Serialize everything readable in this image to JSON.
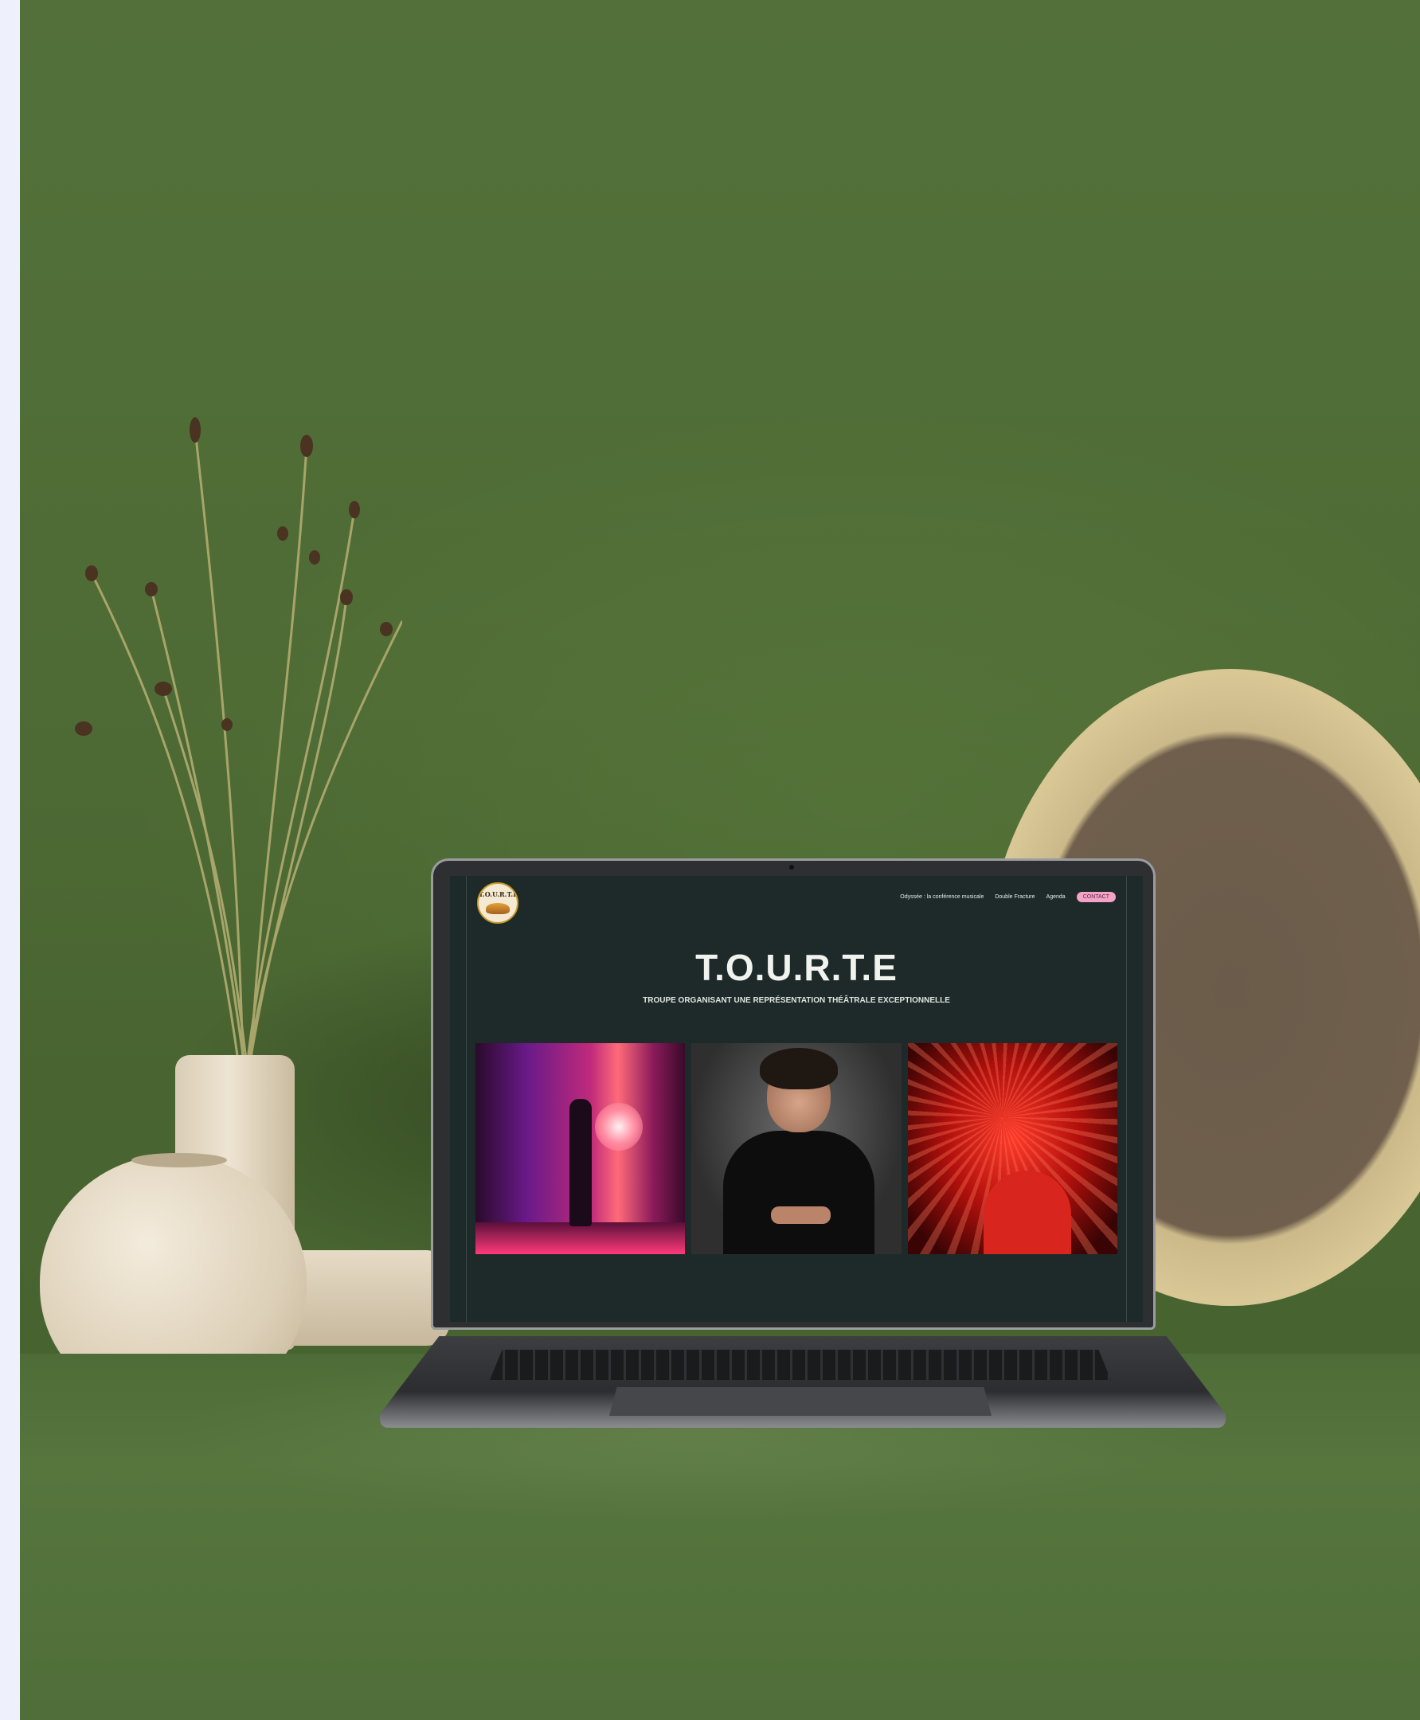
{
  "website": {
    "logo_label": "T.O.U.R.T.E",
    "nav": {
      "item1": "Odyssée : la conférence musicale",
      "item2": "Double Fracture",
      "item3": "Agenda",
      "contact": "CONTACT"
    },
    "hero": {
      "title": "T.O.U.R.T.E",
      "subtitle": "TROUPE ORGANISANT UNE REPRÉSENTATION THÉÂTRALE EXCEPTIONNELLE"
    },
    "photos": [
      {
        "name": "stage-curtain-photo"
      },
      {
        "name": "portrait-photo"
      },
      {
        "name": "red-lights-photo"
      }
    ],
    "colors": {
      "background": "#1e2a2a",
      "contact_button": "#f4a3c8",
      "title_text": "#f1f3ef"
    }
  },
  "scene": {
    "wall_color": "#557439",
    "objects": [
      "dried-flowers",
      "ceramic-vases",
      "clay-bowl",
      "laptop"
    ]
  }
}
